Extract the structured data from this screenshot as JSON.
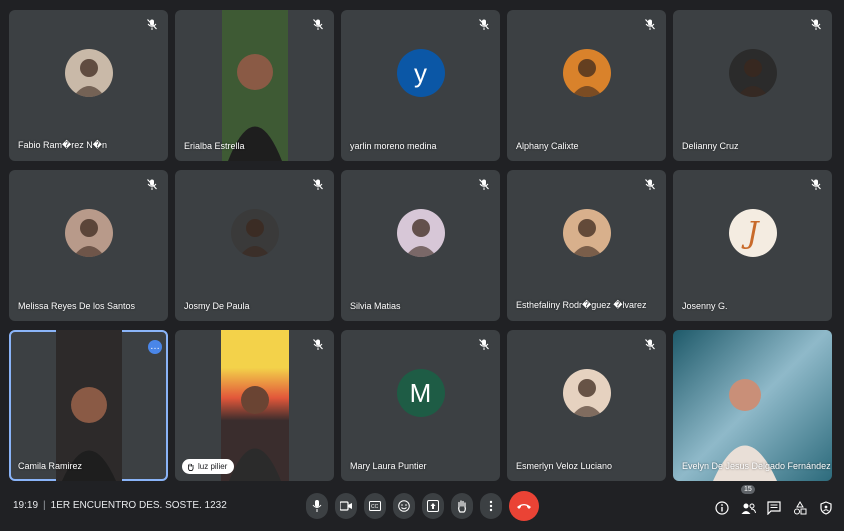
{
  "participants": [
    {
      "name": "Fabio Ram�rez N�n",
      "muted": true,
      "avatar_bg": "#c9b9a8",
      "type": "photo-face"
    },
    {
      "name": "Erialba Estrella",
      "muted": true,
      "type": "video"
    },
    {
      "name": "yarlin moreno medina",
      "muted": true,
      "avatar_bg": "#0b57a6",
      "initial": "y",
      "type": "initial"
    },
    {
      "name": "Alphany Calixte",
      "muted": true,
      "avatar_bg": "#d9822b",
      "type": "photo-face"
    },
    {
      "name": "Delianny Cruz",
      "muted": true,
      "avatar_bg": "#2b2b2b",
      "type": "photo-face"
    },
    {
      "name": "Melissa Reyes De los Santos",
      "muted": true,
      "avatar_bg": "#b89a8a",
      "type": "photo-face"
    },
    {
      "name": "Josmy De Paula",
      "muted": true,
      "avatar_bg": "#3a3a3a",
      "type": "photo-face"
    },
    {
      "name": "Silvia Matias",
      "muted": true,
      "avatar_bg": "#d7c7d7",
      "type": "photo-face"
    },
    {
      "name": "Esthefaliny Rodr�guez �lvarez",
      "muted": true,
      "avatar_bg": "#d8b08c",
      "type": "photo-face"
    },
    {
      "name": "Josenny G.",
      "muted": true,
      "avatar_bg": "#f4ece1",
      "initial": "J",
      "type": "logo"
    },
    {
      "name": "Camila Ramirez",
      "muted": false,
      "type": "video",
      "speaking": true
    },
    {
      "name": "luz pilier",
      "muted": true,
      "type": "video-chip"
    },
    {
      "name": "Mary Laura Puntier",
      "muted": true,
      "avatar_bg": "#1e5c45",
      "initial": "M",
      "type": "initial"
    },
    {
      "name": "Esmerlyn Veloz Luciano",
      "muted": true,
      "avatar_bg": "#e6d2c0",
      "type": "photo-face"
    },
    {
      "name": "Evelyn De Jesus Delgado Fernández",
      "muted": false,
      "type": "video-wide"
    }
  ],
  "meeting": {
    "time": "19:19",
    "title": "1ER ENCUENTRO DES. SOSTE. 1232",
    "participant_count": "15"
  },
  "controls": [
    "microphone-icon",
    "camera-icon",
    "captions-icon",
    "emoji-icon",
    "present-icon",
    "raise-hand-icon",
    "more-options-icon",
    "end-call-icon"
  ],
  "right_tools": [
    "info-icon",
    "people-icon",
    "chat-icon",
    "activities-icon",
    "host-controls-icon"
  ],
  "colors": {
    "background": "#202124",
    "tile": "#3c4043",
    "end_call": "#ea4335",
    "speaking_outline": "#8ab4f8"
  }
}
